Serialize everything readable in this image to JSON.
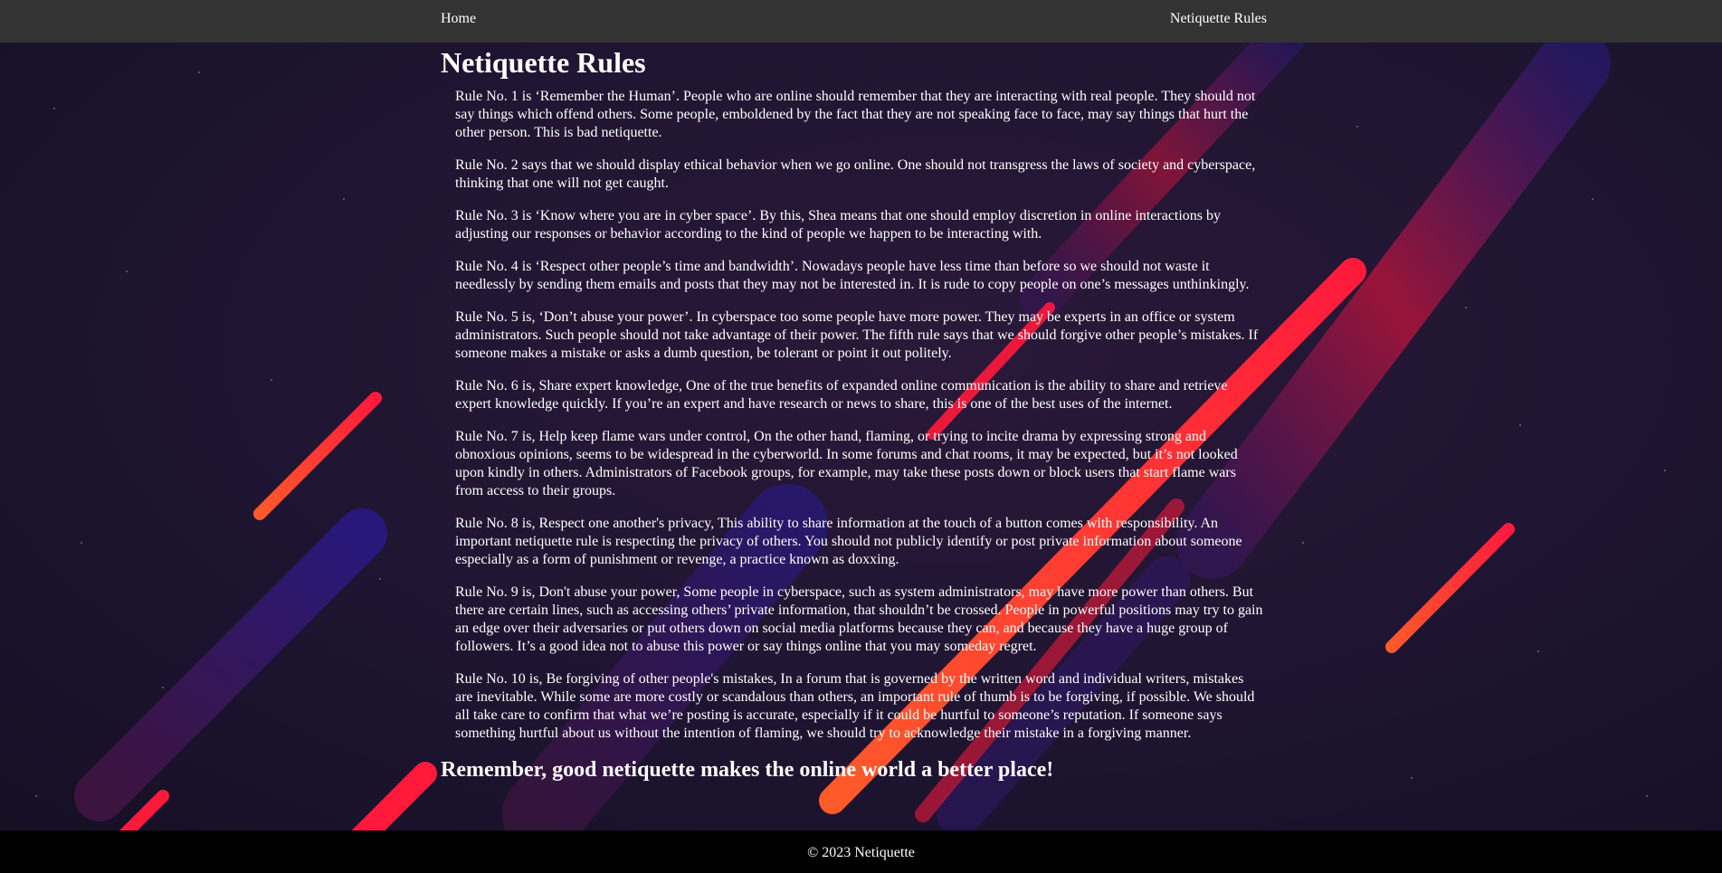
{
  "nav": {
    "home_label": "Home",
    "rules_label": "Netiquette Rules"
  },
  "main": {
    "title": "Netiquette Rules",
    "rules": [
      "Rule No. 1 is ‘Remember the Human’. People who are online should remember that they are interacting with real people. They should not say things which offend others. Some people, emboldened by the fact that they are not speaking face to face, may say things that hurt the other person. This is bad netiquette.",
      "Rule No. 2 says that we should display ethical behavior when we go online. One should not transgress the laws of society and cyberspace, thinking that one will not get caught.",
      "Rule No. 3 is ‘Know where you are in cyber space’. By this, Shea means that one should employ discretion in online interactions by adjusting our responses or behavior according to the kind of people we happen to be interacting with.",
      "Rule No. 4 is ‘Respect other people’s time and bandwidth’. Nowadays people have less time than before so we should not waste it needlessly by sending them emails and posts that they may not be interested in. It is rude to copy people on one’s messages unthinkingly.",
      "Rule No. 5 is, ‘Don’t abuse your power’. In cyberspace too some people have more power. They may be experts in an office or system administrators. Such people should not take advantage of their power. The fifth rule says that we should forgive other people’s mistakes. If someone makes a mistake or asks a dumb question, be tolerant or point it out politely.",
      "Rule No. 6 is, Share expert knowledge, One of the true benefits of expanded online communication is the ability to share and retrieve expert knowledge quickly. If you’re an expert and have research or news to share, this is one of the best uses of the internet.",
      "Rule No. 7 is, Help keep flame wars under control, On the other hand, flaming, or trying to incite drama by expressing strong and obnoxious opinions, seems to be widespread in the cyberworld. In some forums and chat rooms, it may be expected, but it’s not looked upon kindly in others. Administrators of Facebook groups, for example, may take these posts down or block users that start flame wars from access to their groups.",
      "Rule No. 8 is, Respect one another's privacy, This ability to share information at the touch of a button comes with responsibility. An important netiquette rule is respecting the privacy of others. You should not publicly identify or post private information about someone especially as a form of punishment or revenge, a practice known as doxxing.",
      "Rule No. 9 is, Don't abuse your power, Some people in cyberspace, such as system administrators, may have more power than others. But there are certain lines, such as accessing others’ private information, that shouldn’t be crossed. People in powerful positions may try to gain an edge over their adversaries or put others down on social media platforms because they can, and because they have a huge group of followers. It’s a good idea not to abuse this power or say things online that you may someday regret.",
      "Rule No. 10 is, Be forgiving of other people's mistakes, In a forum that is governed by the written word and individual writers, mistakes are inevitable. While some are more costly or scandalous than others, an important rule of thumb is to be forgiving, if possible. We should all take care to confirm that what we’re posting is accurate, especially if it could be hurtful to someone’s reputation. If someone says something hurtful about us without the intention of flaming, we should try to acknowledge their mistake in a forgiving manner."
    ],
    "closing": "Remember, good netiquette makes the online world a better place!"
  },
  "footer": {
    "text": "© 2023 Netiquette"
  },
  "colors": {
    "navbar_bg": "#333333",
    "footer_bg": "#000000",
    "background": "#1b1228",
    "streak_red": "#ff1a3c",
    "streak_orange": "#ff5a2a",
    "streak_purple": "#4a1a8a"
  },
  "icons": {
    "background": "space-streaks-background"
  }
}
